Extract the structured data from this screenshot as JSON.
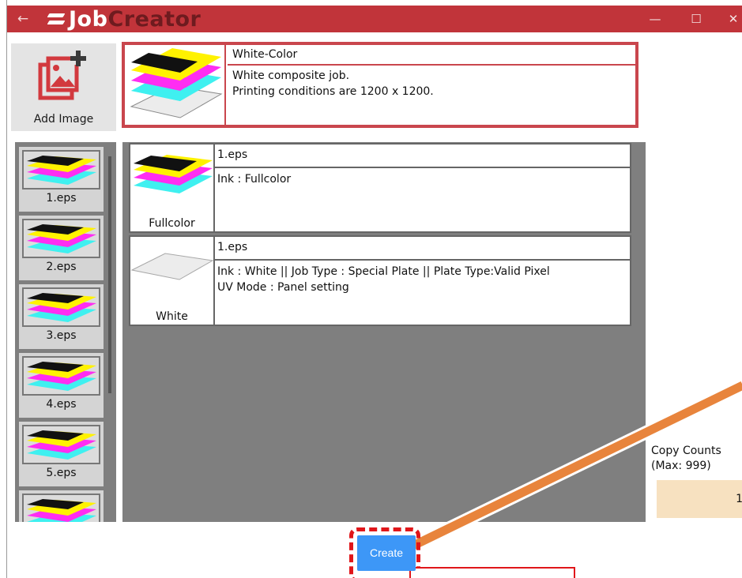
{
  "app": {
    "title_part1": "Job",
    "title_part2": "Creator",
    "back_icon": "←",
    "minimize_icon": "—",
    "maximize_icon": "☐",
    "close_icon": "✕"
  },
  "add_image": {
    "label": "Add Image",
    "icon": "add-image-icon"
  },
  "composite_job": {
    "name": "White-Color",
    "description_line1": "White composite job.",
    "description_line2": "Printing conditions are 1200 x 1200."
  },
  "image_list": [
    {
      "label": "1.eps"
    },
    {
      "label": "2.eps"
    },
    {
      "label": "3.eps"
    },
    {
      "label": "4.eps"
    },
    {
      "label": "5.eps"
    },
    {
      "label": ""
    }
  ],
  "plates": [
    {
      "thumb_label": "Fullcolor",
      "file": "1.eps",
      "info_line1": "Ink : Fullcolor",
      "info_line2": ""
    },
    {
      "thumb_label": "White",
      "file": "1.eps",
      "info_line1": "Ink : White || Job Type : Special Plate || Plate Type:Valid Pixel",
      "info_line2": "UV Mode : Panel setting"
    }
  ],
  "copy_counts": {
    "label_line1": "Copy Counts",
    "label_line2": "(Max: 999)",
    "value": "1"
  },
  "create_button": {
    "label": "Create"
  },
  "colors": {
    "titlebar": "#c1343a",
    "accent_border": "#c9464d",
    "create_button": "#3d97f7",
    "copy_input": "#f7e1c0",
    "highlight": "#e0161a",
    "arrow": "#e8843c"
  }
}
